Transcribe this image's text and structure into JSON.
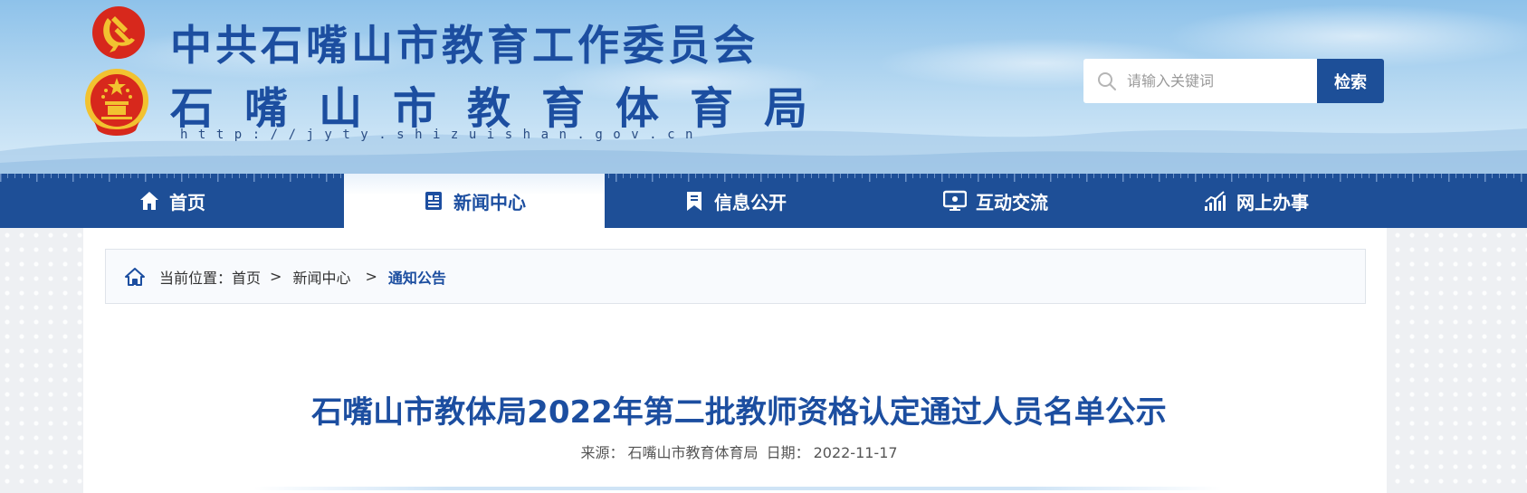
{
  "header": {
    "title_line1": "中共石嘴山市教育工作委员会",
    "title_line2": "石嘴山市教育体育局",
    "url": "http://jyty.shizuishan.gov.cn"
  },
  "search": {
    "placeholder": "请输入关键词",
    "button_label": "检索",
    "icon": "search-icon"
  },
  "nav": {
    "items": [
      {
        "label": "首页",
        "icon": "home-icon",
        "active": false
      },
      {
        "label": "新闻中心",
        "icon": "news-icon",
        "active": true
      },
      {
        "label": "信息公开",
        "icon": "bookmark-icon",
        "active": false
      },
      {
        "label": "互动交流",
        "icon": "monitor-icon",
        "active": false
      },
      {
        "label": "网上办事",
        "icon": "chart-icon",
        "active": false
      }
    ]
  },
  "breadcrumb": {
    "prefix": "当前位置：",
    "items": [
      "首页",
      "新闻中心",
      "通知公告"
    ],
    "separator": ">"
  },
  "article": {
    "title": "石嘴山市教体局2022年第二批教师资格认定通过人员名单公示",
    "source_label": "来源：",
    "source": "石嘴山市教育体育局",
    "date_label": "日期：",
    "date": "2022-11-17"
  },
  "colors": {
    "brand_blue": "#1c4ea0",
    "nav_bg": "#1e4f97",
    "emblem_red": "#d7281c",
    "emblem_gold": "#f2c230"
  }
}
